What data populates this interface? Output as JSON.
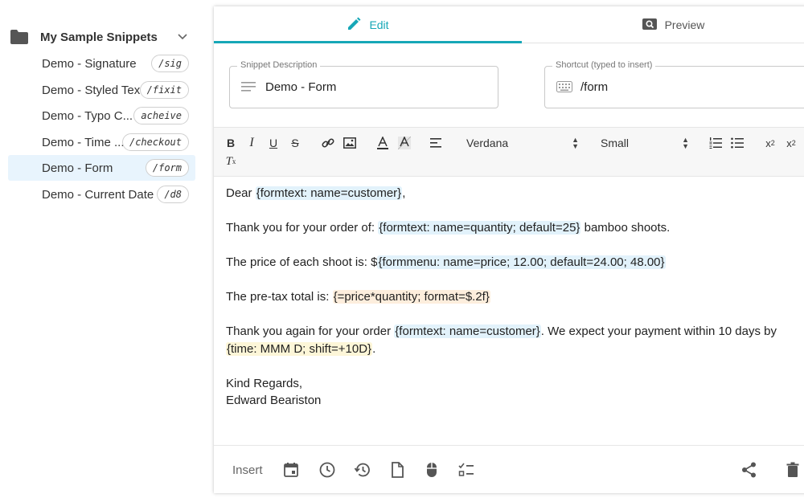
{
  "sidebar": {
    "folder_name": "My Sample Snippets",
    "snippets": [
      {
        "name": "Demo - Signature",
        "shortcut": "/sig"
      },
      {
        "name": "Demo - Styled Text",
        "shortcut": "/fixit"
      },
      {
        "name": "Demo - Typo C...",
        "shortcut": "acheive"
      },
      {
        "name": "Demo - Time ...",
        "shortcut": "/checkout"
      },
      {
        "name": "Demo - Form",
        "shortcut": "/form"
      },
      {
        "name": "Demo - Current Date",
        "shortcut": "/d8"
      }
    ]
  },
  "tabs": {
    "edit": "Edit",
    "preview": "Preview"
  },
  "fields": {
    "description_label": "Snippet Description",
    "description_value": "Demo - Form",
    "shortcut_label": "Shortcut (typed to insert)",
    "shortcut_value": "/form"
  },
  "toolbar": {
    "font": "Verdana",
    "size": "Small",
    "bold": "B",
    "italic": "I",
    "underline": "U",
    "strike": "S"
  },
  "content": {
    "l1_a": "Dear ",
    "l1_chip": "{formtext: name=customer}",
    "l1_b": ",",
    "l2_a": "Thank you for your order of: ",
    "l2_chip": "{formtext: name=quantity; default=25}",
    "l2_b": " bamboo shoots.",
    "l3_a": "The price of each shoot is: $",
    "l3_chip": "{formmenu: name=price; 12.00; default=24.00; 48.00}",
    "l4_a": "The pre-tax total is: ",
    "l4_chip": "{=price*quantity; format=$.2f}",
    "l5_a": "Thank you again for your order ",
    "l5_chip": "{formtext: name=customer}",
    "l5_b": ". We expect your payment within 10 days by",
    "l6_chip": "{time: MMM D; shift=+10D}",
    "l6_b": ".",
    "l7": "Kind Regards,",
    "l8": "Edward Beariston"
  },
  "bottom": {
    "insert_label": "Insert"
  },
  "colors": {
    "accent": "#16a7b7",
    "selected_bg": "#e8f4fd"
  }
}
